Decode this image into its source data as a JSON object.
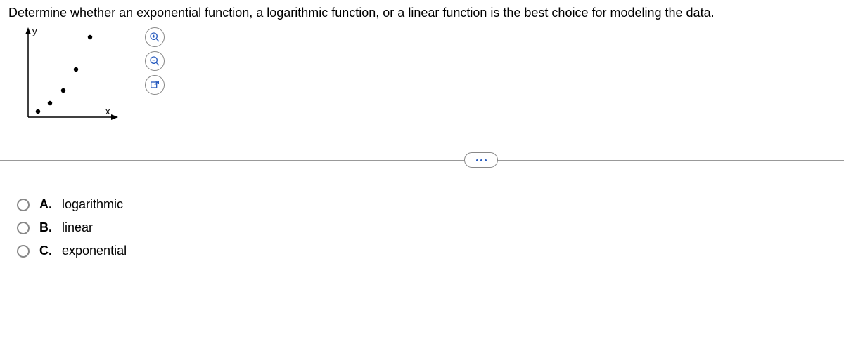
{
  "question": "Determine whether an exponential function, a logarithmic function, or a linear function is the best choice for modeling the data.",
  "axes": {
    "x_label": "x",
    "y_label": "y"
  },
  "tool_icons": {
    "zoom_in": "zoom-in",
    "zoom_out": "zoom-out",
    "open_external": "open-external"
  },
  "options": [
    {
      "letter": "A.",
      "text": "logarithmic"
    },
    {
      "letter": "B.",
      "text": "linear"
    },
    {
      "letter": "C.",
      "text": "exponential"
    }
  ],
  "chart_data": {
    "type": "scatter",
    "title": "",
    "xlabel": "x",
    "ylabel": "y",
    "x": [
      0.6,
      1.3,
      2.1,
      2.9,
      3.7
    ],
    "y": [
      0.4,
      1.1,
      2.1,
      3.8,
      6.5
    ],
    "xlim": [
      0,
      5
    ],
    "ylim": [
      0,
      7
    ]
  }
}
